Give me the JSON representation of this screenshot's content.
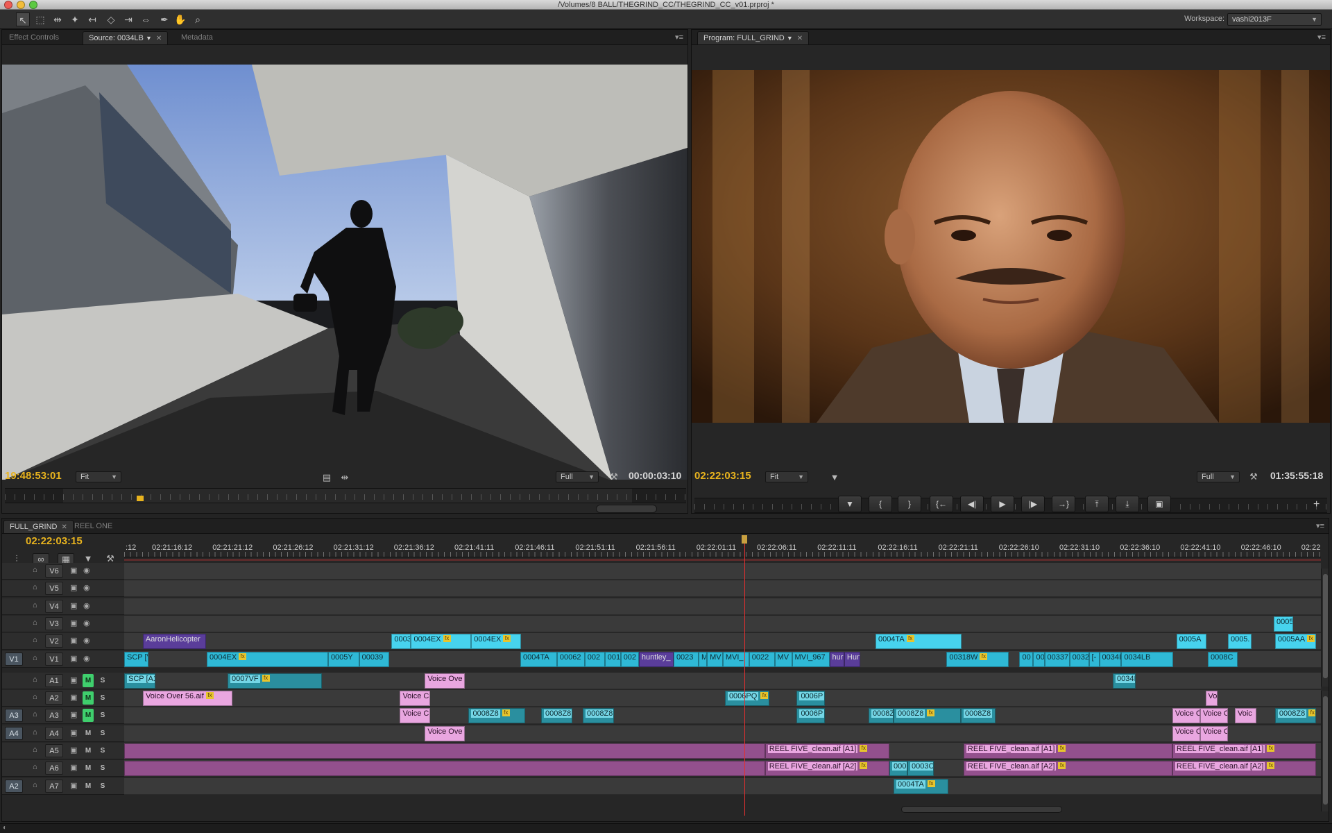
{
  "window": {
    "title": "/Volumes/8 BALL/THEGRIND_CC/THEGRIND_CC_v01.prproj *"
  },
  "toolbar": {
    "tools": [
      "selection-tool",
      "track-select-tool",
      "ripple-edit-tool",
      "rolling-edit-tool",
      "rate-stretch-tool",
      "razor-tool",
      "slip-tool",
      "slide-tool",
      "pen-tool",
      "hand-tool",
      "zoom-tool"
    ],
    "workspace_label": "Workspace:",
    "workspace_value": "vashi2013F"
  },
  "source_panel": {
    "tabs": [
      "Effect Controls",
      "Source: 0034LB",
      "Metadata"
    ],
    "active_tab": "Source: 0034LB",
    "current_tc": "19:48:53:01",
    "fit": "Fit",
    "quality": "Full",
    "duration_tc": "00:00:03:10"
  },
  "program_panel": {
    "tab": "Program: FULL_GRIND",
    "current_tc": "02:22:03:15",
    "fit": "Fit",
    "quality": "Full",
    "duration_tc": "01:35:55:18",
    "transport": [
      "add-marker",
      "mark-in",
      "mark-out",
      "go-to-in",
      "step-back",
      "play",
      "step-forward",
      "go-to-out",
      "lift",
      "extract",
      "export-frame"
    ]
  },
  "timeline": {
    "tabs": [
      "FULL_GRIND",
      "REEL ONE"
    ],
    "active_tab": "FULL_GRIND",
    "current_tc": "02:22:03:15",
    "ruler_labels": [
      ":12",
      "02:21:16:12",
      "02:21:21:12",
      "02:21:26:12",
      "02:21:31:12",
      "02:21:36:12",
      "02:21:41:11",
      "02:21:46:11",
      "02:21:51:11",
      "02:21:56:11",
      "02:22:01:11",
      "02:22:06:11",
      "02:22:11:11",
      "02:22:16:11",
      "02:22:21:11",
      "02:22:26:10",
      "02:22:31:10",
      "02:22:36:10",
      "02:22:41:10",
      "02:22:46:10",
      "02:22"
    ],
    "video_tracks": [
      {
        "name": "V6",
        "target": "",
        "clips": []
      },
      {
        "name": "V5",
        "target": "",
        "clips": []
      },
      {
        "name": "V4",
        "target": "",
        "clips": []
      },
      {
        "name": "V3",
        "target": "",
        "clips": [
          {
            "label": "0005",
            "start": 0.9606,
            "end": 0.9768,
            "style": "video-light",
            "fx": false
          }
        ]
      },
      {
        "name": "V2",
        "target": "",
        "clips": [
          {
            "label": "AaronHelicopter",
            "start": 0.0156,
            "end": 0.0684,
            "style": "purple",
            "fx": false
          },
          {
            "label": "0003",
            "start": 0.2234,
            "end": 0.2397,
            "style": "video-light",
            "fx": false
          },
          {
            "label": "0004EX",
            "start": 0.2397,
            "end": 0.29,
            "style": "video-light",
            "fx": true
          },
          {
            "label": "0004EX",
            "start": 0.29,
            "end": 0.3316,
            "style": "video-light",
            "fx": true
          },
          {
            "label": "0004TA",
            "start": 0.6278,
            "end": 0.6996,
            "style": "video-light",
            "fx": true
          },
          {
            "label": "0005A",
            "start": 0.8792,
            "end": 0.9042,
            "style": "video-light",
            "fx": false
          },
          {
            "label": "0005.",
            "start": 0.9223,
            "end": 0.9423,
            "style": "video-light",
            "fx": false
          },
          {
            "label": "0005AA",
            "start": 0.9617,
            "end": 0.9959,
            "style": "video-light",
            "fx": true
          }
        ]
      },
      {
        "name": "V1",
        "target": "V1",
        "clips": [
          {
            "label": "SCP [V",
            "start": 0.0,
            "end": 0.0203,
            "style": "video-clip",
            "fx": false
          },
          {
            "label": "0004EX",
            "start": 0.069,
            "end": 0.1704,
            "style": "video-clip",
            "fx": true
          },
          {
            "label": "0005Y",
            "start": 0.1704,
            "end": 0.1963,
            "style": "video-clip",
            "fx": false
          },
          {
            "label": "00039",
            "start": 0.1963,
            "end": 0.2212,
            "style": "video-clip",
            "fx": false
          },
          {
            "label": "0004TA",
            "start": 0.331,
            "end": 0.3617,
            "style": "video-clip",
            "fx": false
          },
          {
            "label": "00062",
            "start": 0.3617,
            "end": 0.3848,
            "style": "video-clip",
            "fx": false
          },
          {
            "label": "002",
            "start": 0.3848,
            "end": 0.4016,
            "style": "video-clip",
            "fx": false
          },
          {
            "label": "001",
            "start": 0.4016,
            "end": 0.4149,
            "style": "video-clip",
            "fx": false
          },
          {
            "label": "002",
            "start": 0.4149,
            "end": 0.4301,
            "style": "video-clip",
            "fx": false
          },
          {
            "label": "huntley_",
            "start": 0.4301,
            "end": 0.4591,
            "style": "purple",
            "fx": false
          },
          {
            "label": "0023",
            "start": 0.4591,
            "end": 0.48,
            "style": "video-clip",
            "fx": false
          },
          {
            "label": "M",
            "start": 0.48,
            "end": 0.487,
            "style": "video-clip",
            "fx": false
          },
          {
            "label": "MV",
            "start": 0.487,
            "end": 0.5002,
            "style": "video-clip",
            "fx": false
          },
          {
            "label": "MVI_",
            "start": 0.5002,
            "end": 0.5222,
            "style": "video-clip",
            "fx": false
          },
          {
            "label": "0022",
            "start": 0.5222,
            "end": 0.5435,
            "style": "video-clip",
            "fx": false
          },
          {
            "label": "MV",
            "start": 0.5435,
            "end": 0.558,
            "style": "video-clip",
            "fx": false
          },
          {
            "label": "MVI_967",
            "start": 0.558,
            "end": 0.5893,
            "style": "video-clip",
            "fx": false
          },
          {
            "label": "hur",
            "start": 0.5893,
            "end": 0.6017,
            "style": "purple",
            "fx": false
          },
          {
            "label": "Hun",
            "start": 0.6017,
            "end": 0.6149,
            "style": "purple",
            "fx": false
          },
          {
            "label": "00318W",
            "start": 0.6872,
            "end": 0.7394,
            "style": "video-clip",
            "fx": true
          },
          {
            "label": "00",
            "start": 0.7481,
            "end": 0.7597,
            "style": "video-clip",
            "fx": false
          },
          {
            "label": "00",
            "start": 0.7597,
            "end": 0.769,
            "style": "video-clip",
            "fx": false
          },
          {
            "label": "00337",
            "start": 0.769,
            "end": 0.7899,
            "style": "video-clip",
            "fx": false
          },
          {
            "label": "0032I3",
            "start": 0.7899,
            "end": 0.8061,
            "style": "video-clip",
            "fx": false
          },
          {
            "label": "[-",
            "start": 0.8061,
            "end": 0.8148,
            "style": "video-clip",
            "fx": false
          },
          {
            "label": "0034I",
            "start": 0.8148,
            "end": 0.8333,
            "style": "video-clip",
            "fx": false
          },
          {
            "label": "0034LB",
            "start": 0.8333,
            "end": 0.8768,
            "style": "video-clip",
            "fx": false
          },
          {
            "label": "0008C",
            "start": 0.9055,
            "end": 0.9304,
            "style": "video-clip",
            "fx": false
          }
        ]
      }
    ],
    "audio_tracks": [
      {
        "name": "A1",
        "target": "",
        "m_on": true,
        "clips": [
          {
            "label": "SCP [A1]",
            "start": 0.0,
            "end": 0.0261,
            "style": "audio-teal",
            "fx": false
          },
          {
            "label": "0007VF",
            "start": 0.0864,
            "end": 0.1652,
            "style": "audio-teal",
            "fx": true
          },
          {
            "label": "Voice Ove",
            "start": 0.2512,
            "end": 0.2848,
            "style": "audio-pink",
            "fx": false
          },
          {
            "label": "0034I",
            "start": 0.8261,
            "end": 0.8452,
            "style": "audio-teal",
            "fx": false
          }
        ]
      },
      {
        "name": "A2",
        "target": "",
        "m_on": true,
        "clips": [
          {
            "label": "Voice Over 56.aif",
            "start": 0.0157,
            "end": 0.0904,
            "style": "audio-pink",
            "fx": true
          },
          {
            "label": "Voice C",
            "start": 0.2304,
            "end": 0.2559,
            "style": "audio-pink",
            "fx": false
          },
          {
            "label": "0006PQ",
            "start": 0.502,
            "end": 0.5391,
            "style": "audio-teal",
            "fx": true
          },
          {
            "label": "0006P",
            "start": 0.562,
            "end": 0.5855,
            "style": "audio-teal",
            "fx": false
          },
          {
            "label": "Vo",
            "start": 0.9035,
            "end": 0.9139,
            "style": "audio-pink",
            "fx": false
          }
        ]
      },
      {
        "name": "A3",
        "target": "A3",
        "m_on": true,
        "clips": [
          {
            "label": "Voice C",
            "start": 0.2304,
            "end": 0.2559,
            "style": "audio-pink",
            "fx": false
          },
          {
            "label": "0008Z8",
            "start": 0.2878,
            "end": 0.3351,
            "style": "audio-teal",
            "fx": true
          },
          {
            "label": "0008Z8",
            "start": 0.3484,
            "end": 0.3745,
            "style": "audio-teal",
            "fx": false
          },
          {
            "label": "0008Z8",
            "start": 0.3832,
            "end": 0.4093,
            "style": "audio-teal",
            "fx": false
          },
          {
            "label": "0006P",
            "start": 0.562,
            "end": 0.5855,
            "style": "audio-teal",
            "fx": false
          },
          {
            "label": "0008Z",
            "start": 0.622,
            "end": 0.6429,
            "style": "audio-teal",
            "fx": false
          },
          {
            "label": "0008Z8",
            "start": 0.6429,
            "end": 0.6991,
            "style": "audio-teal",
            "fx": true
          },
          {
            "label": "0008Z8",
            "start": 0.6991,
            "end": 0.7281,
            "style": "audio-teal",
            "fx": false
          },
          {
            "label": "Voice C",
            "start": 0.8759,
            "end": 0.8991,
            "style": "audio-pink",
            "fx": false
          },
          {
            "label": "Voice O",
            "start": 0.8991,
            "end": 0.9223,
            "style": "audio-pink",
            "fx": false
          },
          {
            "label": "Voic",
            "start": 0.9281,
            "end": 0.9461,
            "style": "audio-pink",
            "fx": false
          },
          {
            "label": "0008Z8",
            "start": 0.9617,
            "end": 0.9959,
            "style": "audio-teal",
            "fx": true
          }
        ]
      },
      {
        "name": "A4",
        "target": "A4",
        "m_on": false,
        "clips": [
          {
            "label": "Voice Ove",
            "start": 0.2512,
            "end": 0.2848,
            "style": "audio-pink",
            "fx": false
          },
          {
            "label": "Voice C",
            "start": 0.8759,
            "end": 0.8991,
            "style": "audio-pink",
            "fx": false
          },
          {
            "label": "Voice O",
            "start": 0.8991,
            "end": 0.9223,
            "style": "audio-pink",
            "fx": false
          }
        ]
      },
      {
        "name": "A5",
        "target": "",
        "m_on": false,
        "clips": [
          {
            "label": "",
            "start": 0.0,
            "end": 0.5355,
            "style": "audio-magenta",
            "fx": false
          },
          {
            "label": "REEL FIVE_clean.aif [A1]",
            "start": 0.5355,
            "end": 0.6394,
            "style": "audio-magenta",
            "fx": true
          },
          {
            "label": "REEL FIVE_clean.aif [A1]",
            "start": 0.7014,
            "end": 0.8759,
            "style": "audio-magenta",
            "fx": true
          },
          {
            "label": "REEL FIVE_clean.aif [A1]",
            "start": 0.8759,
            "end": 0.9959,
            "style": "audio-magenta",
            "fx": true
          }
        ]
      },
      {
        "name": "A6",
        "target": "",
        "m_on": false,
        "clips": [
          {
            "label": "",
            "start": 0.0,
            "end": 0.5355,
            "style": "audio-magenta",
            "fx": false
          },
          {
            "label": "REEL FIVE_clean.aif [A2]",
            "start": 0.5355,
            "end": 0.6394,
            "style": "audio-magenta",
            "fx": true
          },
          {
            "label": "000",
            "start": 0.6394,
            "end": 0.6545,
            "style": "audio-teal",
            "fx": false
          },
          {
            "label": "0003C",
            "start": 0.6545,
            "end": 0.6765,
            "style": "audio-teal",
            "fx": false
          },
          {
            "label": "REEL FIVE_clean.aif [A2]",
            "start": 0.7014,
            "end": 0.8759,
            "style": "audio-magenta",
            "fx": true
          },
          {
            "label": "REEL FIVE_clean.aif [A2]",
            "start": 0.8759,
            "end": 0.9959,
            "style": "audio-magenta",
            "fx": true
          }
        ]
      },
      {
        "name": "A7",
        "target": "A2",
        "m_on": false,
        "clips": [
          {
            "label": "0004TA",
            "start": 0.6429,
            "end": 0.6887,
            "style": "audio-teal",
            "fx": true
          }
        ]
      }
    ]
  },
  "colors": {
    "timecode": "#e8b31e",
    "playhead": "#e23030",
    "video_clip": "#2fb9d6",
    "audio_clip": "#e9a6e0",
    "mute_on": "#3fcf6d"
  }
}
